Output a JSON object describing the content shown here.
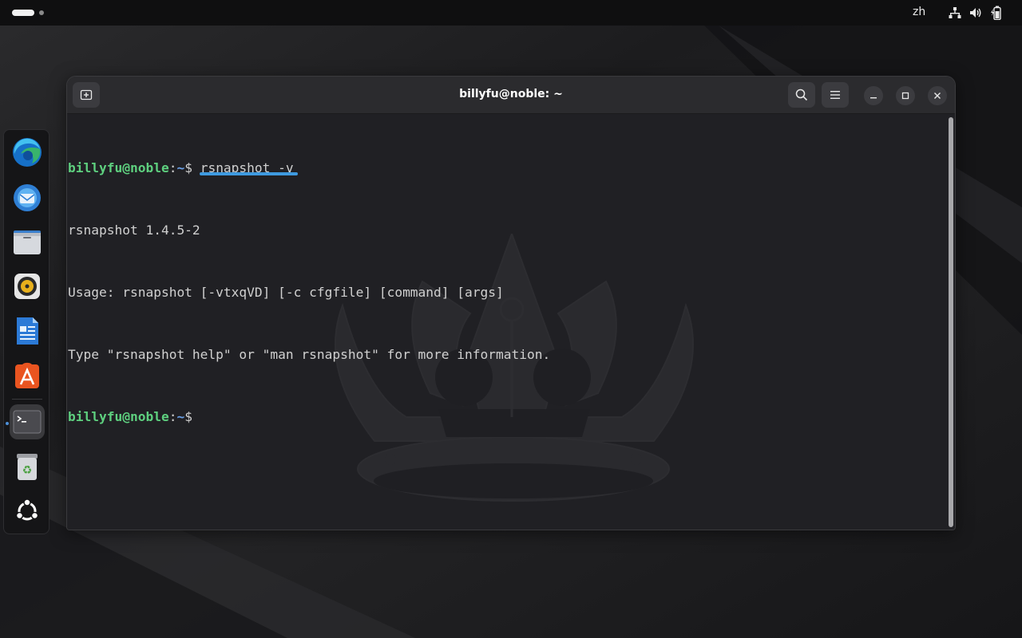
{
  "topbar": {
    "language": "zh",
    "tray_icons": [
      "network-icon",
      "volume-icon",
      "battery-icon"
    ]
  },
  "dock": {
    "apps": [
      {
        "name": "Microsoft Edge",
        "icon": "edge-icon"
      },
      {
        "name": "Thunderbird",
        "icon": "thunderbird-icon"
      },
      {
        "name": "Files",
        "icon": "files-icon"
      },
      {
        "name": "Rhythmbox",
        "icon": "rhythmbox-icon"
      },
      {
        "name": "LibreOffice Writer",
        "icon": "writer-icon"
      },
      {
        "name": "App Center",
        "icon": "app-center-icon"
      },
      {
        "name": "Terminal",
        "icon": "terminal-icon",
        "active": true
      },
      {
        "name": "Trash",
        "icon": "trash-icon"
      },
      {
        "name": "Show Apps",
        "icon": "ubuntu-apps-icon"
      }
    ]
  },
  "window": {
    "title": "billyfu@noble: ~"
  },
  "terminal": {
    "prompt_user": "billyfu@noble",
    "prompt_colon": ":",
    "prompt_path": "~",
    "prompt_symbol": "$",
    "lines": [
      {
        "type": "command",
        "text": " rsnapshot -v"
      },
      {
        "type": "output",
        "text": "rsnapshot 1.4.5-2"
      },
      {
        "type": "output",
        "text": "Usage: rsnapshot [-vtxqVD] [-c cfgfile] [command] [args]"
      },
      {
        "type": "output",
        "text": "Type \"rsnapshot help\" or \"man rsnapshot\" for more information."
      },
      {
        "type": "command",
        "text": ""
      }
    ]
  },
  "colors": {
    "prompt_user": "#5ed07f",
    "prompt_path": "#6aa0e8",
    "highlight_underline": "#3e9ae0"
  }
}
